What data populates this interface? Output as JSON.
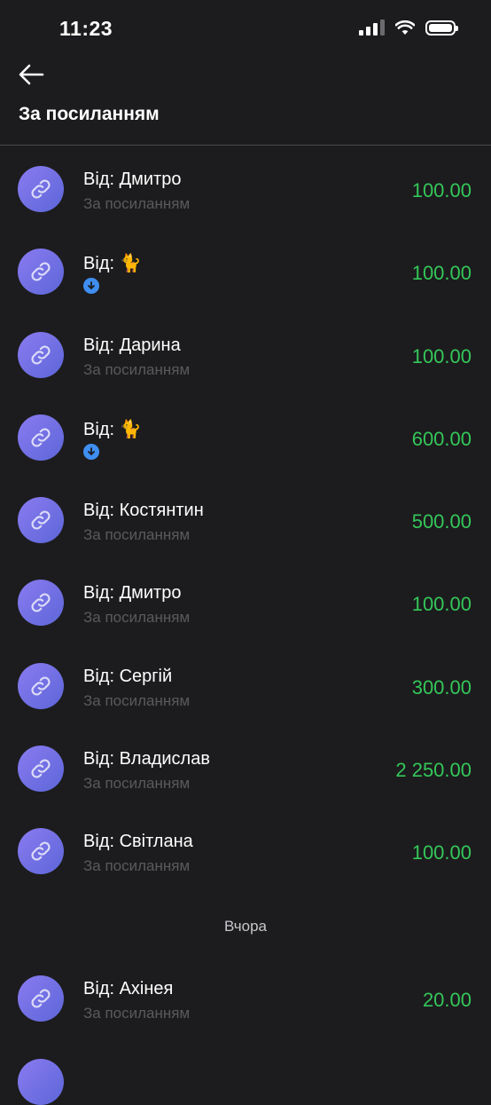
{
  "status_bar": {
    "time": "11:23"
  },
  "header": {
    "title": "За посиланням"
  },
  "transactions": [
    {
      "title": "Від: Дмитро",
      "subtitle": "За посиланням",
      "amount": "100.00"
    },
    {
      "title": "Від: 🐈",
      "subtitle": "",
      "amount": "100.00",
      "sub_icon": "download-badge-icon"
    },
    {
      "title": "Від: Дарина",
      "subtitle": "За посиланням",
      "amount": "100.00"
    },
    {
      "title": "Від: 🐈",
      "subtitle": "",
      "amount": "600.00",
      "sub_icon": "download-badge-icon"
    },
    {
      "title": "Від: Костянтин",
      "subtitle": "За посиланням",
      "amount": "500.00"
    },
    {
      "title": "Від: Дмитро",
      "subtitle": "За посиланням",
      "amount": "100.00"
    },
    {
      "title": "Від: Сергій",
      "subtitle": "За посиланням",
      "amount": "300.00"
    },
    {
      "title": "Від: Владислав",
      "subtitle": "За посиланням",
      "amount": "2 250.00"
    },
    {
      "title": "Від: Світлана",
      "subtitle": "За посиланням",
      "amount": "100.00"
    }
  ],
  "date_separator": "Вчора",
  "yesterday_transactions": [
    {
      "title": "Від: Ахінея",
      "subtitle": "За посиланням",
      "amount": "20.00"
    }
  ],
  "colors": {
    "background": "#1c1c1e",
    "amount": "#34c759",
    "avatar": "#6f6fe6",
    "subtitle": "#5a5a5e"
  }
}
